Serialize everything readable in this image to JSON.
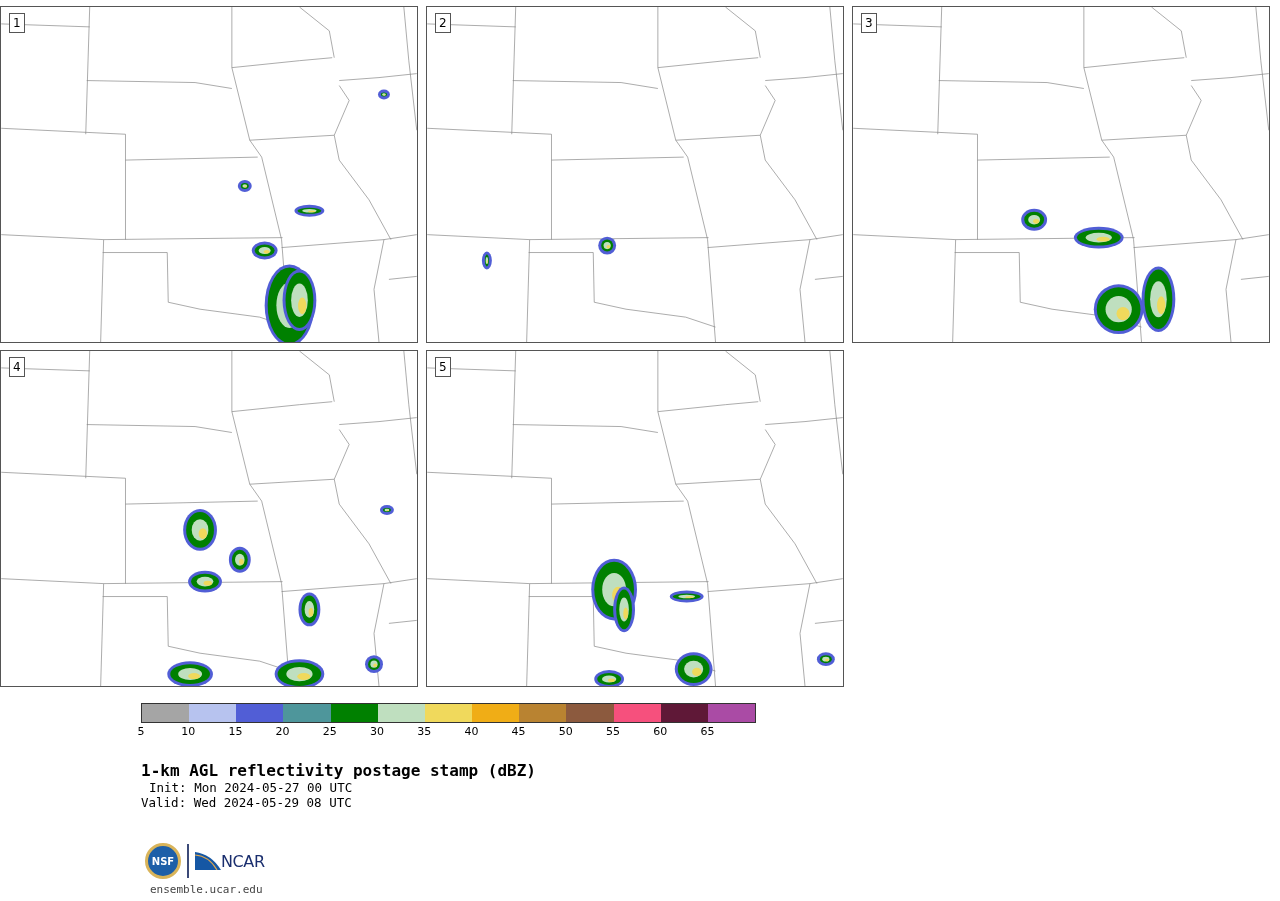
{
  "panels": [
    {
      "label": "1"
    },
    {
      "label": "2"
    },
    {
      "label": "3"
    },
    {
      "label": "4"
    },
    {
      "label": "5"
    }
  ],
  "colorbar": {
    "segments": [
      {
        "color": "#a5a5a5"
      },
      {
        "color": "#b7c3ef"
      },
      {
        "color": "#515ed6"
      },
      {
        "color": "#4e969b"
      },
      {
        "color": "#008000"
      },
      {
        "color": "#bfdfbf"
      },
      {
        "color": "#f0d95c"
      },
      {
        "color": "#f0ad16"
      },
      {
        "color": "#b98331"
      },
      {
        "color": "#8c5a3e"
      },
      {
        "color": "#f6507d"
      },
      {
        "color": "#5f1837"
      },
      {
        "color": "#aa4ba5"
      }
    ],
    "ticks": [
      "5",
      "10",
      "15",
      "20",
      "25",
      "30",
      "35",
      "40",
      "45",
      "50",
      "55",
      "60",
      "65"
    ]
  },
  "title": "1-km AGL reflectivity postage stamp (dBZ)",
  "init": "Init: Mon 2024-05-27 00 UTC",
  "valid": "Valid: Wed 2024-05-29 08 UTC",
  "logos": {
    "nsf": "NSF",
    "ncar": "NCAR"
  },
  "footer": "ensemble.ucar.edu"
}
